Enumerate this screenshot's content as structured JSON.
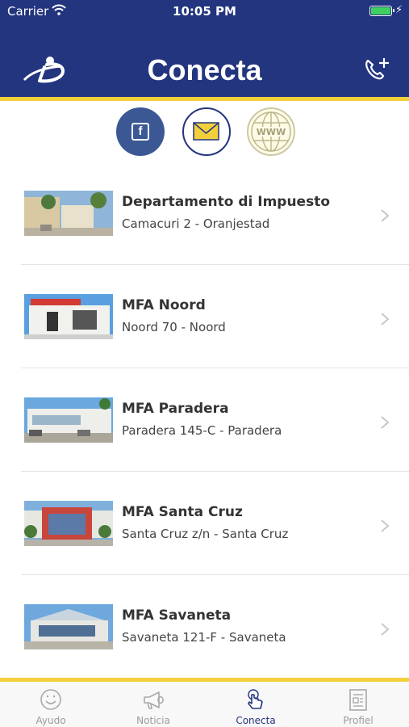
{
  "status_bar": {
    "carrier": "Carrier",
    "time": "10:05 PM"
  },
  "header": {
    "title": "Conecta"
  },
  "colors": {
    "header": "#23357e",
    "gold": "#f3cf3c",
    "facebook": "#3b5895"
  },
  "social": [
    {
      "name": "facebook",
      "icon": "facebook-icon"
    },
    {
      "name": "email",
      "icon": "mail-icon"
    },
    {
      "name": "website",
      "icon": "globe-www-icon"
    }
  ],
  "locations": [
    {
      "name": "Departamento di Impuesto",
      "address": "Camacuri 2 - Oranjestad"
    },
    {
      "name": "MFA Noord",
      "address": "Noord 70 - Noord"
    },
    {
      "name": "MFA Paradera",
      "address": "Paradera 145-C - Paradera"
    },
    {
      "name": "MFA Santa Cruz",
      "address": "Santa Cruz z/n - Santa Cruz"
    },
    {
      "name": "MFA Savaneta",
      "address": "Savaneta 121-F - Savaneta"
    }
  ],
  "tabs": [
    {
      "label": "Ayudo",
      "icon": "smiley-icon",
      "active": false
    },
    {
      "label": "Noticia",
      "icon": "megaphone-icon",
      "active": false
    },
    {
      "label": "Conecta",
      "icon": "touch-hand-icon",
      "active": true
    },
    {
      "label": "Profiel",
      "icon": "profile-card-icon",
      "active": false
    }
  ]
}
